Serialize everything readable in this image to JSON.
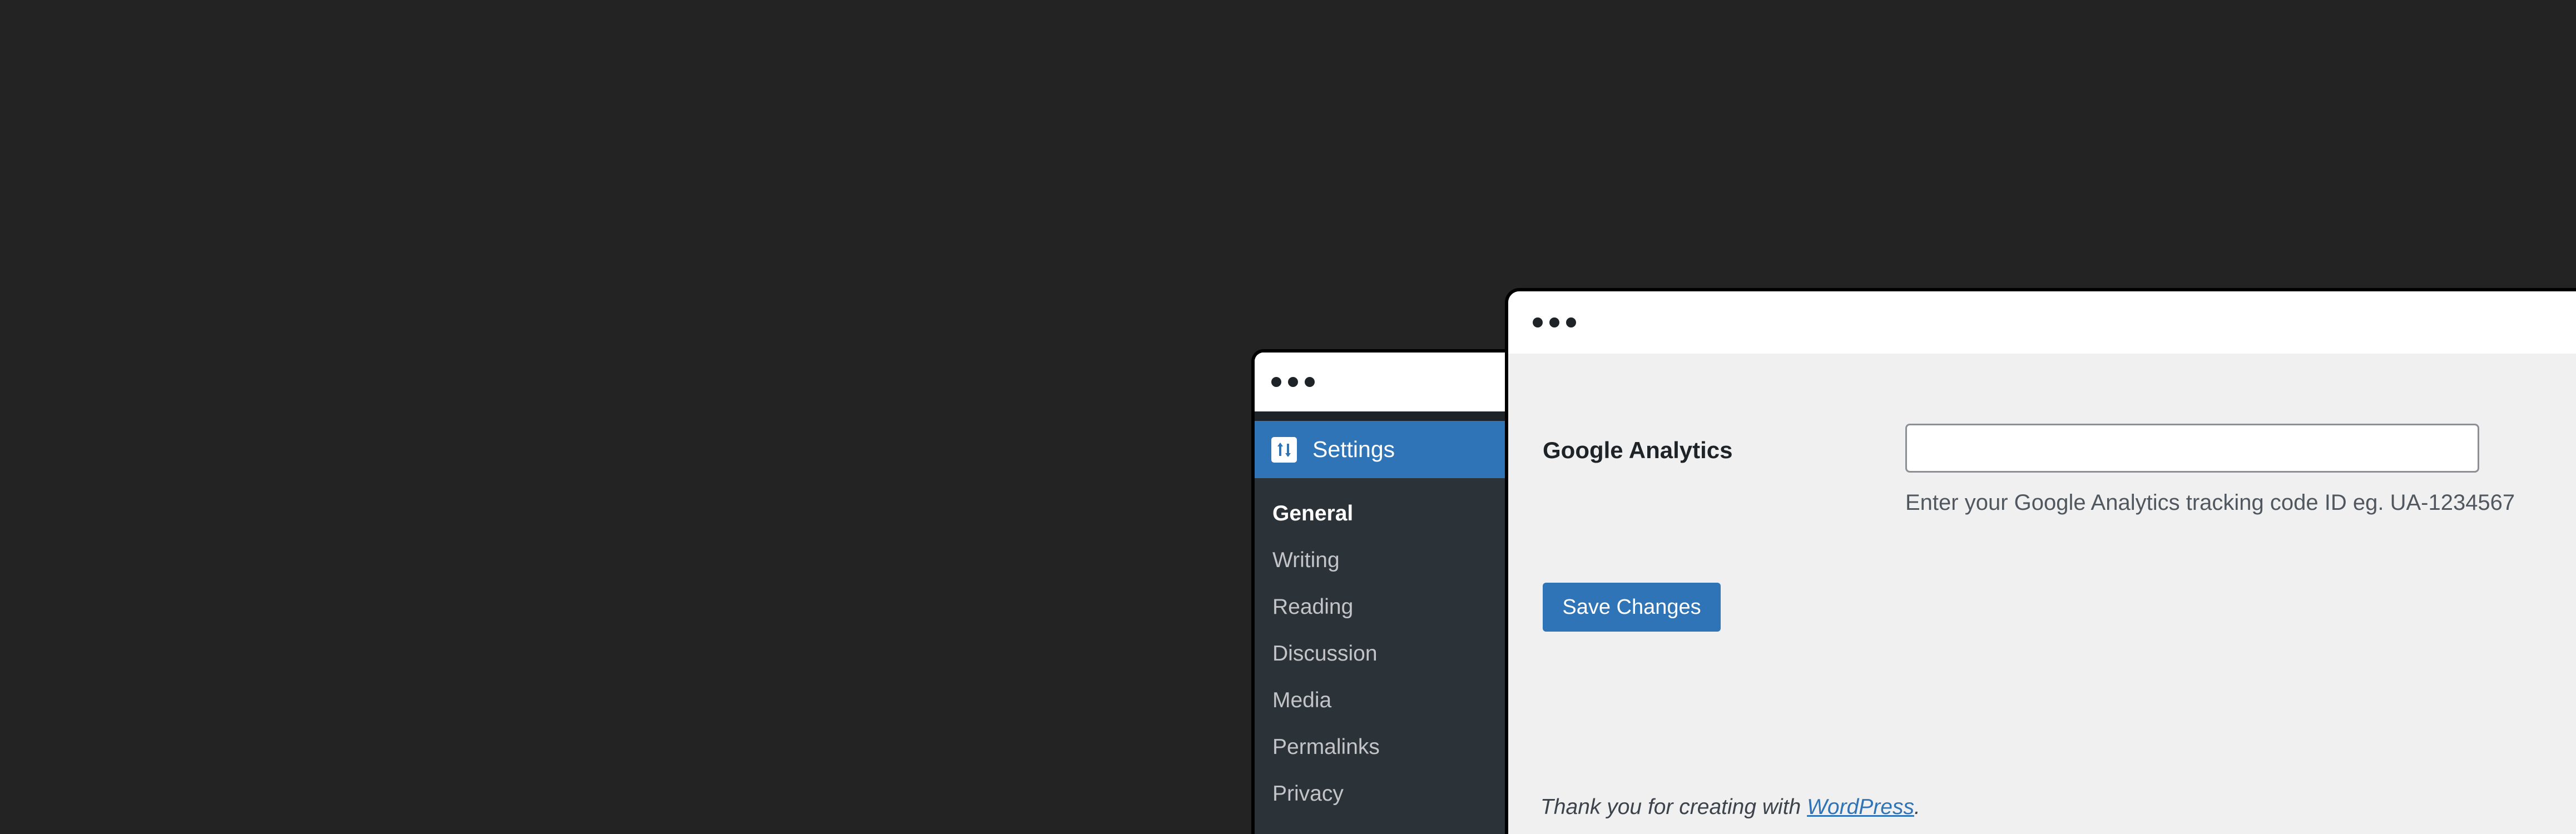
{
  "colors": {
    "background": "#232323",
    "admin_menu": "#2c3338",
    "accent": "#2f74b6",
    "content_bg": "#f0f0f1"
  },
  "back_window": {
    "menu": {
      "settings_label": "Settings",
      "settings_icon": "settings-sliders-icon",
      "items": [
        {
          "label": "General",
          "current": true
        },
        {
          "label": "Writing"
        },
        {
          "label": "Reading"
        },
        {
          "label": "Discussion"
        },
        {
          "label": "Media"
        },
        {
          "label": "Permalinks"
        },
        {
          "label": "Privacy"
        }
      ]
    }
  },
  "front_window": {
    "field": {
      "label": "Google Analytics",
      "value": "",
      "description": "Enter your Google Analytics tracking code ID eg. UA-1234567"
    },
    "save_button": "Save Changes",
    "footer": {
      "prefix": "Thank you for creating with ",
      "link": "WordPress",
      "suffix": "."
    }
  }
}
